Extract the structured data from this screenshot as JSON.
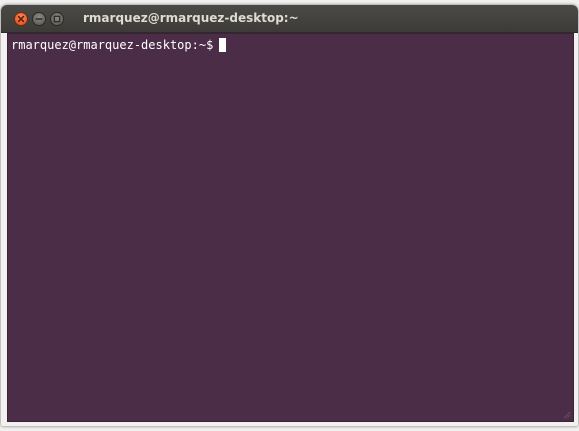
{
  "window": {
    "title": "rmarquez@rmarquez-desktop:~"
  },
  "titlebar_buttons": {
    "close": "close-icon",
    "minimize": "minimize-icon",
    "maximize": "maximize-icon"
  },
  "terminal": {
    "prompt": "rmarquez@rmarquez-desktop:~$",
    "background_color": "#4c2d47",
    "text_color": "#ffffff"
  },
  "colors": {
    "titlebar": "#3c3b37",
    "close_button": "#df4a16",
    "title_text": "#dfdbd2"
  }
}
